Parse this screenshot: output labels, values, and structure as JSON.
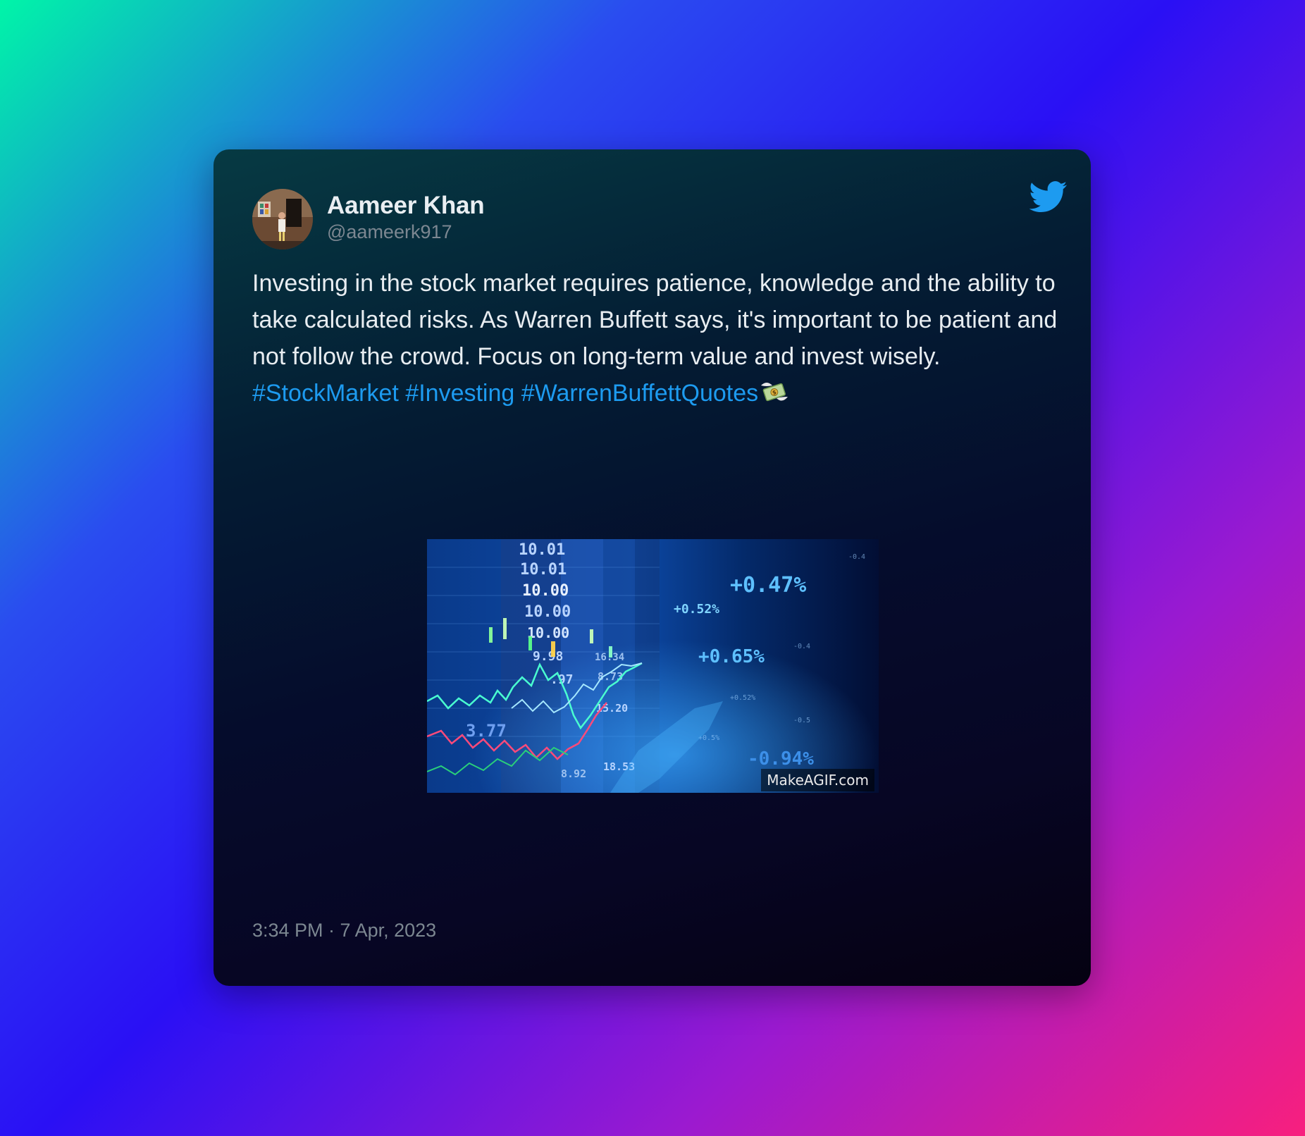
{
  "tweet": {
    "author": {
      "name": "Aameer Khan",
      "handle": "@aameerk917",
      "avatar": "profile-photo"
    },
    "text": {
      "body": "Investing in the stock market requires patience, knowledge and the ability to take calculated risks. As Warren Buffett says, it's important to be patient and not follow the crowd. Focus on long-term value and invest wisely. ",
      "hashtags": [
        "#StockMarket",
        "#Investing",
        "#WarrenBuffettQuotes"
      ],
      "trailing_emoji": "money-with-wings-icon"
    },
    "media": {
      "type": "animated-gif",
      "watermark": "MakeAGIF.com",
      "overlay_labels": [
        "10.01",
        "10.01",
        "10.00",
        "10.00",
        "10.00",
        "9.98",
        ".97",
        "15.20",
        "8.73",
        "16.34",
        "18.53",
        "8.92",
        "3.77",
        "+0.52%",
        "+0.47%",
        "+0.65%",
        "-0.94%"
      ]
    },
    "timestamp": "3:34 PM · 7 Apr, 2023",
    "brand_icon": "twitter-bird-icon"
  },
  "colors": {
    "accent": "#1d9bf0",
    "text": "#e8edf1",
    "muted": "#7c8791"
  }
}
